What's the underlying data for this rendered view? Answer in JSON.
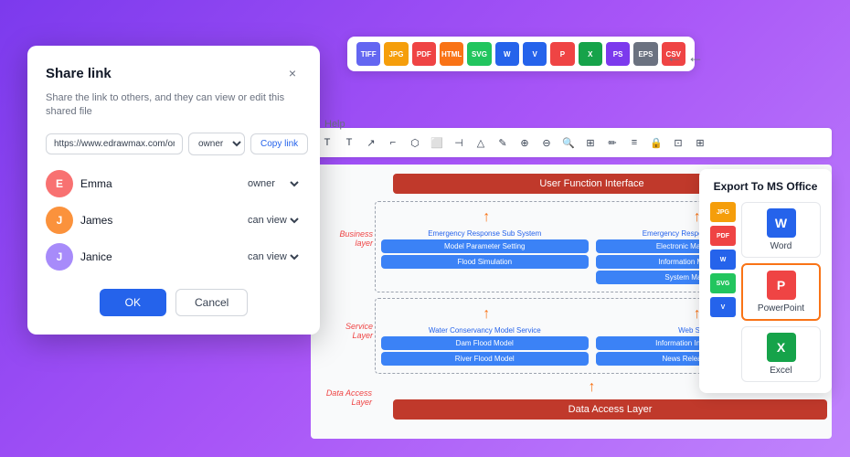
{
  "background": {
    "gradient_start": "#7c3aed",
    "gradient_end": "#c084fc"
  },
  "file_formats": [
    {
      "label": "TIFF",
      "color": "#6366f1"
    },
    {
      "label": "JPG",
      "color": "#f59e0b"
    },
    {
      "label": "PDF",
      "color": "#ef4444"
    },
    {
      "label": "HTML",
      "color": "#f97316"
    },
    {
      "label": "SVG",
      "color": "#22c55e"
    },
    {
      "label": "W",
      "color": "#2563eb"
    },
    {
      "label": "V",
      "color": "#2563eb"
    },
    {
      "label": "P",
      "color": "#ef4444"
    },
    {
      "label": "X",
      "color": "#16a34a"
    },
    {
      "label": "PS",
      "color": "#7c3aed"
    },
    {
      "label": "EPS",
      "color": "#6b7280"
    },
    {
      "label": "CSV",
      "color": "#ef4444"
    }
  ],
  "toolbar": {
    "help_label": "Help",
    "icons": [
      "T",
      "T↗",
      "⌐",
      "⬡",
      "⬜",
      "⊣",
      "⊤",
      "△",
      "⟆",
      "✎",
      "⊕",
      "⊖",
      "🔍",
      "⊞",
      "✏",
      "≡",
      "🔒",
      "⊡",
      "⊞"
    ]
  },
  "diagram": {
    "user_function_label": "User Function Interface",
    "business_layer_label": "Business layer",
    "service_layer_label": "Service Layer",
    "data_access_layer_label": "Data Access Layer",
    "subsystem1_label": "Emergency Response Sub System",
    "subsystem2_label": "Emergency Response Sub System",
    "subsystem1_boxes": [
      "Model Parameter Setting",
      "Flood Simulation"
    ],
    "subsystem2_boxes": [
      "Electronic Map Application",
      "Information Management",
      "System Maintenance"
    ],
    "water_service_label": "Water Conservancy Model Service",
    "web_service_label": "Web Service",
    "water_boxes": [
      "Dam Flood Model",
      "River Flood Model"
    ],
    "web_boxes": [
      "Information Inquiry Service",
      "News Release Service"
    ],
    "data_access_bar": "Data Access Layer"
  },
  "export_panel": {
    "title": "Export To MS Office",
    "items": [
      {
        "label": "Word",
        "icon": "W",
        "color": "#2563eb",
        "selected": false
      },
      {
        "label": "PowerPoint",
        "icon": "P",
        "color": "#ef4444",
        "selected": true
      },
      {
        "label": "Excel",
        "icon": "X",
        "color": "#16a34a",
        "selected": false
      }
    ],
    "small_icons": [
      {
        "label": "JPG",
        "color": "#f59e0b"
      },
      {
        "label": "PDF",
        "color": "#ef4444"
      },
      {
        "label": "W",
        "color": "#2563eb"
      },
      {
        "label": "SVG",
        "color": "#22c55e"
      },
      {
        "label": "V",
        "color": "#2563eb"
      }
    ]
  },
  "share_dialog": {
    "title": "Share link",
    "close_label": "×",
    "description": "Share the link to others, and they can view or edit this shared file",
    "link_value": "https://www.edrawmax.com/online/fili",
    "link_placeholder": "https://www.edrawmax.com/online/fili",
    "owner_option": "owner",
    "copy_button_label": "Copy link",
    "users": [
      {
        "name": "Emma",
        "role": "owner",
        "avatar_color": "#f87171",
        "initials": "E"
      },
      {
        "name": "James",
        "role": "can view",
        "avatar_color": "#fb923c",
        "initials": "J"
      },
      {
        "name": "Janice",
        "role": "can view",
        "avatar_color": "#a78bfa",
        "initials": "J"
      }
    ],
    "ok_label": "OK",
    "cancel_label": "Cancel"
  }
}
